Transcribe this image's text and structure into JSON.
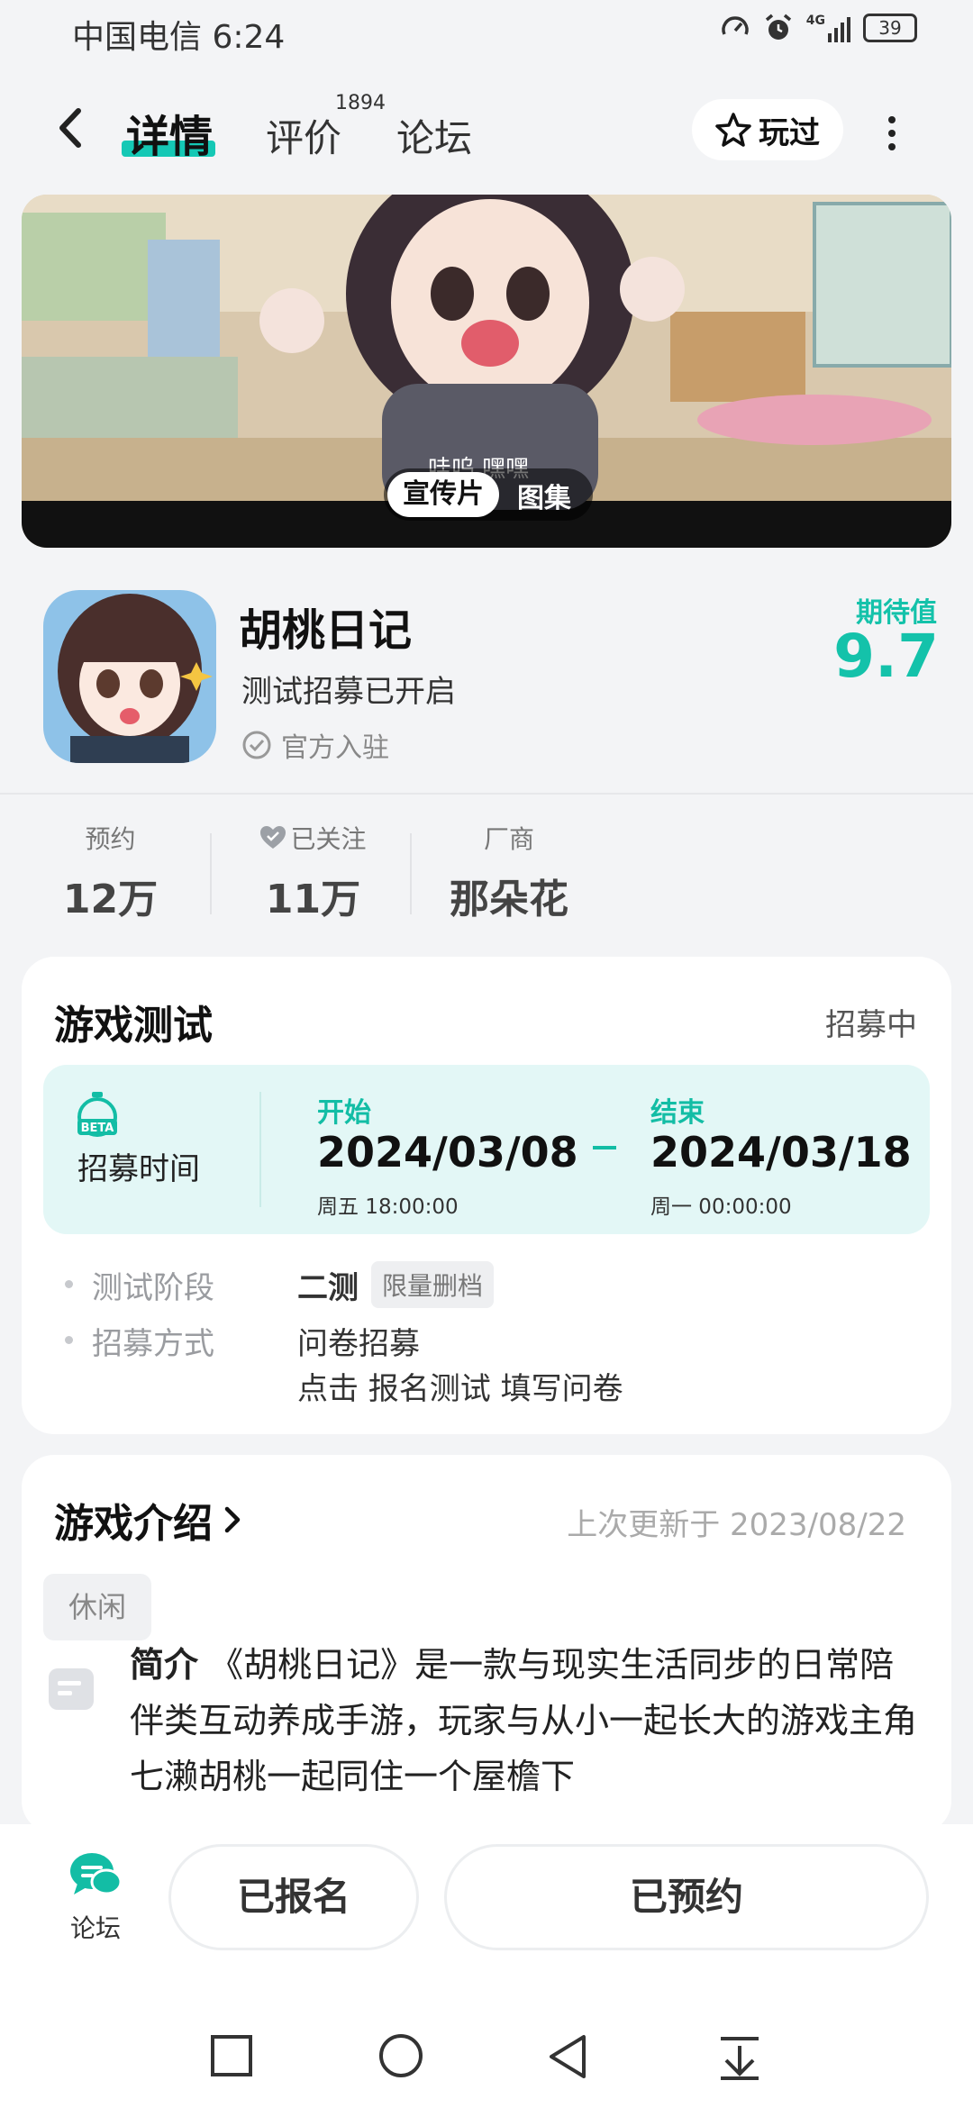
{
  "status_bar": {
    "carrier_time": "中国电信 6:24",
    "signal_label": "4G",
    "battery": "39"
  },
  "header": {
    "tabs": [
      {
        "label": "详情",
        "active": true
      },
      {
        "label": "评价",
        "count": "1894"
      },
      {
        "label": "论坛"
      }
    ],
    "played_label": "玩过"
  },
  "banner": {
    "caption": "哇呜 嘿嘿",
    "media_tabs": [
      "宣传片",
      "图集"
    ]
  },
  "game": {
    "name": "胡桃日记",
    "subtitle": "测试招募已开启",
    "official_label": "官方入驻",
    "expect_label": "期待值",
    "expect_score": "9.7",
    "accent_color": "#14c2aa"
  },
  "stats": [
    {
      "label": "预约",
      "value": "12万"
    },
    {
      "label": "已关注",
      "value": "11万",
      "icon": "heart-icon"
    },
    {
      "label": "厂商",
      "value": "那朵花"
    }
  ],
  "test_card": {
    "title": "游戏测试",
    "status": "招募中",
    "recruit_label": "招募时间",
    "start_head": "开始",
    "start_date": "2024/03/08",
    "start_sub": "周五  18:00:00",
    "end_head": "结束",
    "end_date": "2024/03/18",
    "end_sub": "周一  00:00:00",
    "stage_label": "测试阶段",
    "stage_value": "二测",
    "stage_tag": "限量删档",
    "method_label": "招募方式",
    "method_value": "问卷招募",
    "method_detail": "点击 报名测试 填写问卷"
  },
  "intro_card": {
    "title": "游戏介绍",
    "updated": "上次更新于 2023/08/22",
    "tag": "休闲",
    "summary_label": "简介",
    "summary_text": "《胡桃日记》是一款与现实生活同步的日常陪伴类互动养成手游，玩家与从小一起长大的游戏主角七濑胡桃一起同住一个屋檐下"
  },
  "bottom": {
    "forum_label": "论坛",
    "registered_label": "已报名",
    "reserved_label": "已预约"
  }
}
